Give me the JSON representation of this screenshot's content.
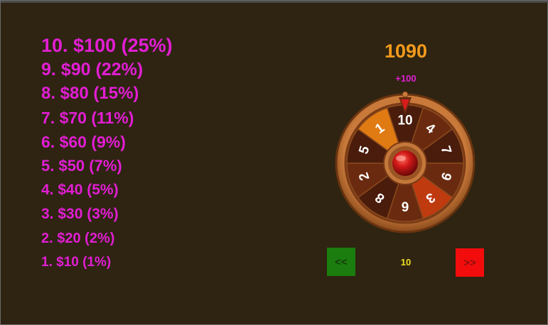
{
  "prize_table": [
    {
      "label": "10. $100 (25%)"
    },
    {
      "label": "9. $90 (22%)"
    },
    {
      "label": "8. $80 (15%)"
    },
    {
      "label": "7. $70 (11%)"
    },
    {
      "label": "6. $60 (9%)"
    },
    {
      "label": "5. $50 (7%)"
    },
    {
      "label": "4. $40 (5%)"
    },
    {
      "label": "3. $30 (3%)"
    },
    {
      "label": "2. $20 (2%)"
    },
    {
      "label": "1. $10 (1%)"
    }
  ],
  "score": {
    "total": "1090",
    "last_win": "+100"
  },
  "wheel": {
    "segments": [
      "10",
      "4",
      "7",
      "9",
      "3",
      "6",
      "8",
      "2",
      "5",
      "1"
    ],
    "highlighted": [
      "1",
      "3"
    ],
    "pointer_icon": "pointer-triangle-icon",
    "colors": {
      "rim": "#b8692d",
      "segment_dark": "#4a1c0c",
      "segment_mid": "#6a2a10",
      "highlight_orange": "#e07a12",
      "highlight_red": "#c03a10",
      "hub": "#c21212"
    }
  },
  "controls": {
    "prev_label": "<<",
    "next_label": ">>",
    "bet_value": "10",
    "colors": {
      "prev_bg": "#1b7d0e",
      "next_bg": "#f20c0c",
      "bet_text": "#f0e020"
    }
  },
  "theme": {
    "background": "#2e2411",
    "prize_text": "#e21ed3",
    "score_text": "#f39a1c"
  }
}
